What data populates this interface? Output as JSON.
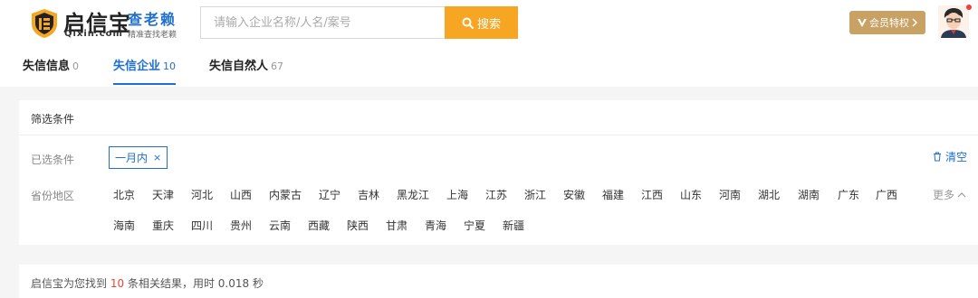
{
  "brand": {
    "name": "启信宝",
    "domain": "Qixin.com",
    "sub_title": "查老赖",
    "sub_slogan": "精准查找老赖"
  },
  "search": {
    "placeholder": "请输入企业名称/人名/案号",
    "button_label": "搜索"
  },
  "header": {
    "vip_label": "会员特权",
    "has_notification": true
  },
  "tabs": [
    {
      "label": "失信信息",
      "count": "0",
      "active": false
    },
    {
      "label": "失信企业",
      "count": "10",
      "active": true
    },
    {
      "label": "失信自然人",
      "count": "67",
      "active": false
    }
  ],
  "filters": {
    "title": "筛选条件",
    "selected_label": "已选条件",
    "selected_tag": "一月内",
    "clear_label": "清空",
    "province_label": "省份地区",
    "more_label": "更多",
    "provinces_row1": [
      "北京",
      "天津",
      "河北",
      "山西",
      "内蒙古",
      "辽宁",
      "吉林",
      "黑龙江",
      "上海",
      "江苏",
      "浙江",
      "安徽",
      "福建",
      "江西",
      "山东",
      "河南",
      "湖北",
      "湖南",
      "广东",
      "广西"
    ],
    "provinces_row2": [
      "海南",
      "重庆",
      "四川",
      "贵州",
      "云南",
      "西藏",
      "陕西",
      "甘肃",
      "青海",
      "宁夏",
      "新疆"
    ]
  },
  "result": {
    "prefix": "启信宝为您找到",
    "count": "10",
    "middle": "条相关结果，用时",
    "time": "0.018",
    "suffix": "秒"
  },
  "colors": {
    "accent_blue": "#1e6fd0",
    "search_orange": "#f6a623",
    "vip_gold": "#c8a265",
    "highlight_red": "#f04134"
  }
}
